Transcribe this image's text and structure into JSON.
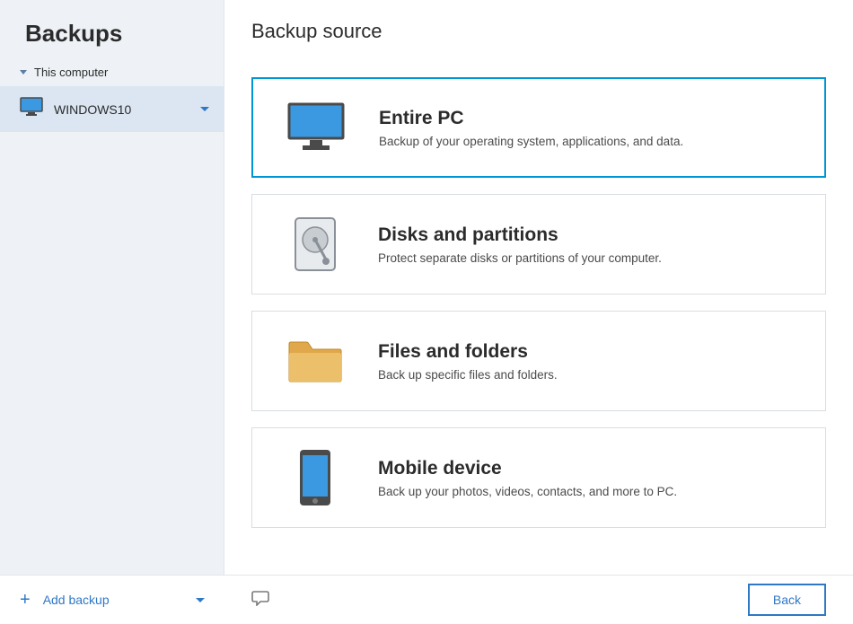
{
  "sidebar": {
    "title": "Backups",
    "tree_label": "This computer",
    "items": [
      {
        "label": "WINDOWS10"
      }
    ]
  },
  "main": {
    "title": "Backup source",
    "options": [
      {
        "title": "Entire PC",
        "desc": "Backup of your operating system, applications, and data."
      },
      {
        "title": "Disks and partitions",
        "desc": "Protect separate disks or partitions of your computer."
      },
      {
        "title": "Files and folders",
        "desc": "Back up specific files and folders."
      },
      {
        "title": "Mobile device",
        "desc": "Back up your photos, videos, contacts, and more to PC."
      }
    ]
  },
  "footer": {
    "add_label": "Add backup",
    "back_label": "Back"
  }
}
